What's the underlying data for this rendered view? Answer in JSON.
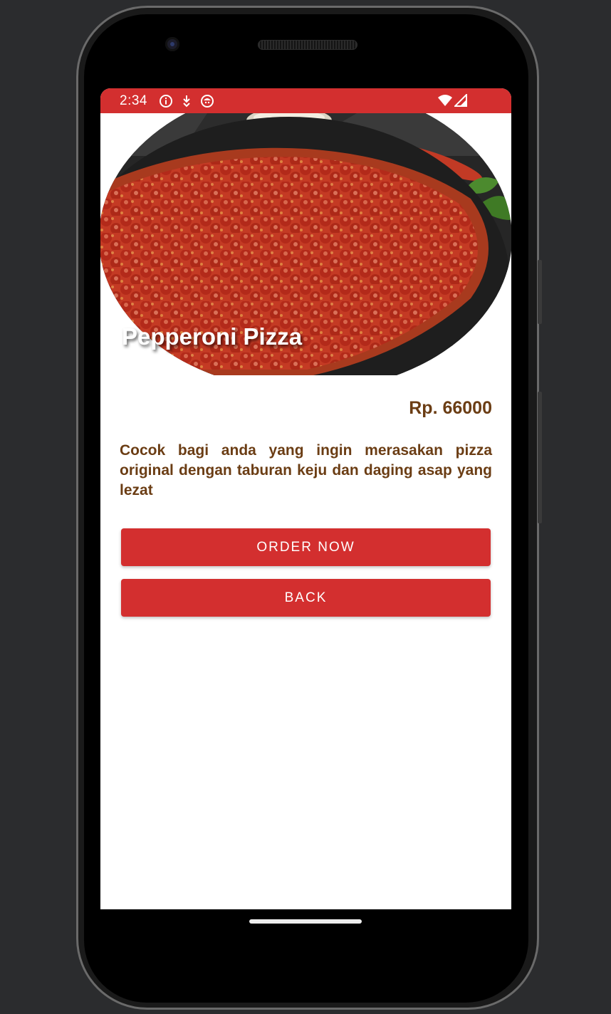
{
  "status_bar": {
    "time": "2:34",
    "icons_left": [
      "info-icon",
      "download-icon",
      "app-notification-icon"
    ],
    "icons_right": [
      "wifi-icon",
      "cellular-signal-icon"
    ],
    "color": "#d32f2f"
  },
  "product": {
    "name": "Pepperoni Pizza",
    "price": "Rp. 66000",
    "description": "Cocok bagi anda yang ingin merasakan pizza original dengan taburan keju dan daging asap yang lezat"
  },
  "actions": {
    "order_label": "ORDER NOW",
    "back_label": "BACK"
  },
  "colors": {
    "accent": "#d32f2f",
    "text_brown": "#6b3d14"
  }
}
